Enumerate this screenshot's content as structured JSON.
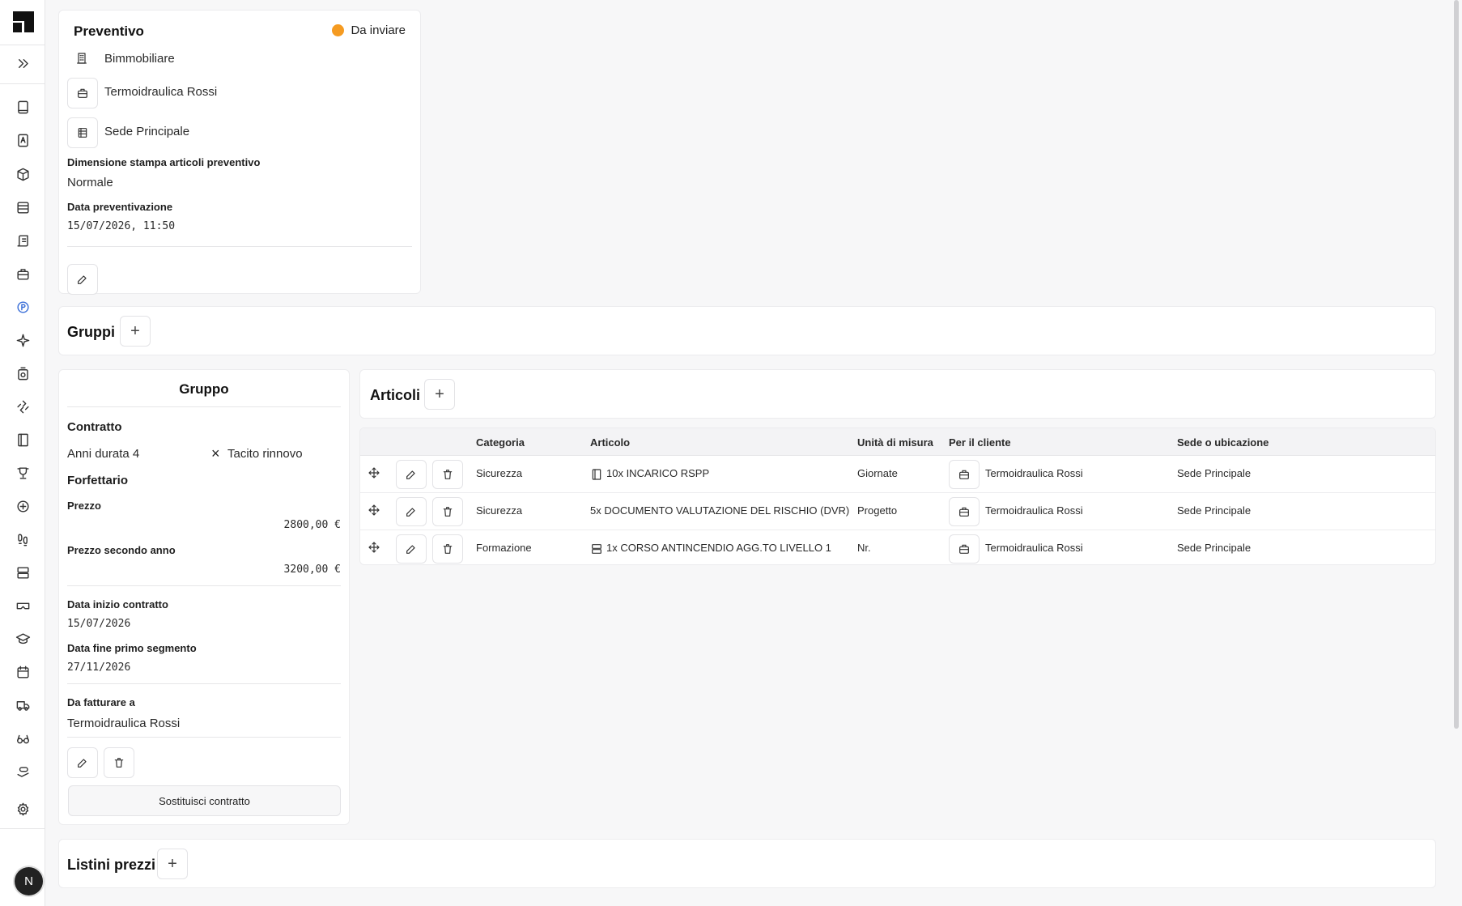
{
  "preventivo": {
    "title": "Preventivo",
    "status": "Da inviare",
    "status_color": "#f59b21",
    "company": "Bimmobiliare",
    "client": "Termoidraulica Rossi",
    "site": "Sede Principale",
    "print_size_label": "Dimensione stampa articoli preventivo",
    "print_size_value": "Normale",
    "date_label": "Data preventivazione",
    "date_value": "15/07/2026, 11:50"
  },
  "gruppi": {
    "title": "Gruppi",
    "add": "+"
  },
  "gruppo": {
    "title": "Gruppo",
    "contract_label": "Contratto",
    "duration": "Anni durata 4",
    "tacit_renewal": "Tacito rinnovo",
    "tacit_icon": "×",
    "flat_rate_label": "Forfettario",
    "price_label": "Prezzo",
    "price_value": "2800,00 €",
    "second_year_label": "Prezzo secondo anno",
    "second_year_value": "3200,00 €",
    "start_label": "Data inizio contratto",
    "start_value": "15/07/2026",
    "end_label": "Data fine primo segmento",
    "end_value": "27/11/2026",
    "invoice_label": "Da fatturare a",
    "invoice_value": "Termoidraulica Rossi",
    "replace_button": "Sostituisci contratto"
  },
  "articoli": {
    "title": "Articoli",
    "add": "+",
    "columns": [
      "Categoria",
      "Articolo",
      "Unità di misura",
      "Per il cliente",
      "Sede o ubicazione"
    ],
    "rows": [
      {
        "category": "Sicurezza",
        "article_icon": "book-icon",
        "article": "10x INCARICO RSPP",
        "unit": "Giornate",
        "client": "Termoidraulica Rossi",
        "site": "Sede Principale"
      },
      {
        "category": "Sicurezza",
        "article_icon": "",
        "article": "5x DOCUMENTO VALUTAZIONE DEL RISCHIO (DVR)",
        "unit": "Progetto",
        "client": "Termoidraulica Rossi",
        "site": "Sede Principale"
      },
      {
        "category": "Formazione",
        "article_icon": "server-icon",
        "article": "1x CORSO ANTINCENDIO AGG.TO LIVELLO 1",
        "unit": "Nr.",
        "client": "Termoidraulica Rossi",
        "site": "Sede Principale"
      }
    ]
  },
  "listini": {
    "title": "Listini prezzi",
    "add": "+"
  },
  "user": {
    "initial": "N"
  }
}
